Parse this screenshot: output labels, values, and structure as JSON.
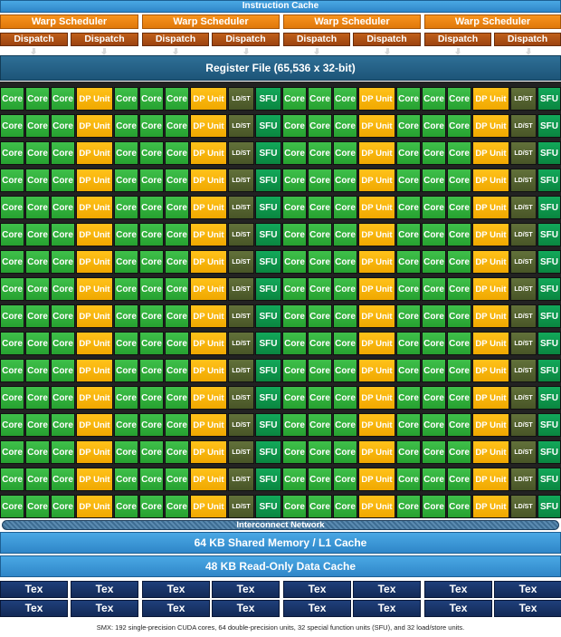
{
  "instruction_cache": "Instruction Cache",
  "warp_schedulers": [
    "Warp Scheduler",
    "Warp Scheduler",
    "Warp Scheduler",
    "Warp Scheduler"
  ],
  "dispatch_units": [
    "Dispatch",
    "Dispatch",
    "Dispatch",
    "Dispatch",
    "Dispatch",
    "Dispatch",
    "Dispatch",
    "Dispatch"
  ],
  "register_file": "Register File (65,536 x 32-bit)",
  "unit_labels": {
    "core": "Core",
    "dp": "DP Unit",
    "ldst": "LD/ST",
    "sfu": "SFU"
  },
  "column_pattern": [
    "core",
    "core",
    "core",
    "dp",
    "core",
    "core",
    "core",
    "dp",
    "ldst",
    "sfu",
    "core",
    "core",
    "core",
    "dp",
    "core",
    "core",
    "core",
    "dp",
    "ldst",
    "sfu"
  ],
  "row_count": 16,
  "interconnect": "Interconnect Network",
  "shared_memory": "64 KB Shared Memory / L1 Cache",
  "readonly_cache": "48 KB Read-Only Data Cache",
  "tex_label": "Tex",
  "tex_rows": 2,
  "tex_cols": 8,
  "caption": "SMX: 192 single-precision CUDA cores, 64 double-precision units, 32 special function units (SFU), and 32 load/store units.",
  "colors": {
    "core": "#27a130",
    "dp": "#f0a800",
    "ldst": "#485527",
    "sfu": "#0a8640",
    "scheduler": "#e0780a",
    "dispatch": "#9c4310",
    "register_file": "#1d5578",
    "cache": "#2f86c8",
    "tex": "#132a57"
  }
}
